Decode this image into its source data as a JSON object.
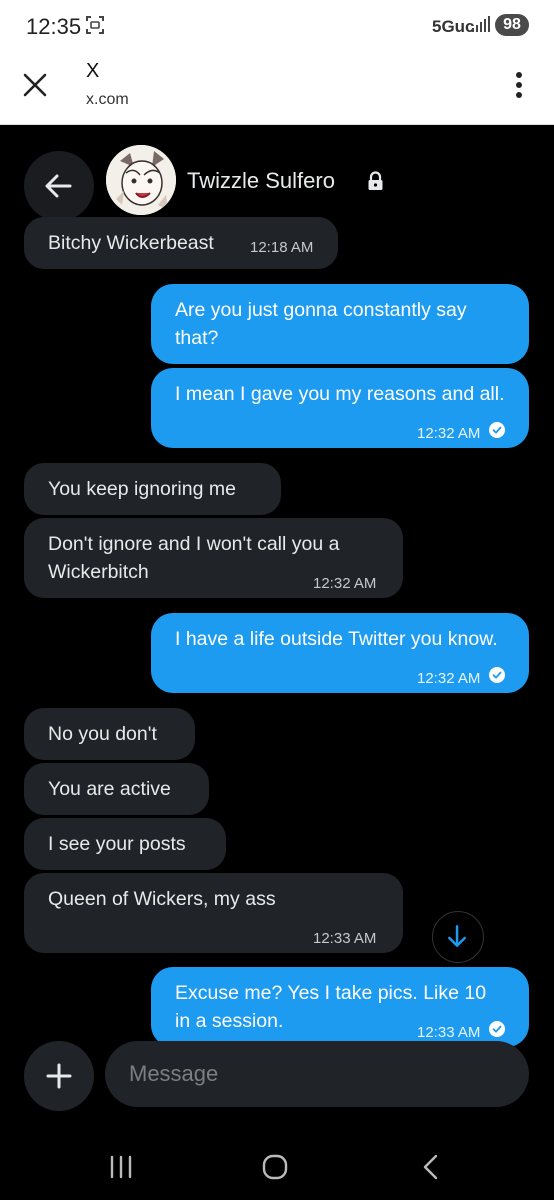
{
  "status_bar": {
    "time": "12:35",
    "network": "5Guc",
    "battery": "98"
  },
  "browser": {
    "title": "X",
    "url": "x.com"
  },
  "conversation": {
    "contact_name": "Twizzle Sulfero",
    "messages": [
      {
        "dir": "received",
        "text": "Bitchy Wickerbeast",
        "time": "12:18 AM"
      },
      {
        "dir": "sent",
        "text": "Are you just gonna constantly say that?",
        "time": ""
      },
      {
        "dir": "sent",
        "text": "I mean I gave you my reasons and all.",
        "time": "12:32 AM",
        "seen": true
      },
      {
        "dir": "received",
        "text": "You keep ignoring me",
        "time": ""
      },
      {
        "dir": "received",
        "text": "Don't ignore and I won't call you a Wickerbitch",
        "time": "12:32 AM"
      },
      {
        "dir": "sent",
        "text": "I have a life outside Twitter you know.",
        "time": "12:32 AM",
        "seen": true
      },
      {
        "dir": "received",
        "text": "No you don't",
        "time": ""
      },
      {
        "dir": "received",
        "text": "You are active",
        "time": ""
      },
      {
        "dir": "received",
        "text": "I see your posts",
        "time": ""
      },
      {
        "dir": "received",
        "text": "Queen of Wickers, my ass",
        "time": "12:33 AM"
      },
      {
        "dir": "sent",
        "text": "Excuse me? Yes I take pics. Like 10 in a session.",
        "time": "12:33 AM",
        "seen": true
      }
    ]
  },
  "composer": {
    "placeholder": "Message"
  },
  "colors": {
    "sent_bubble": "#1d9bf0",
    "received_bubble": "#202327",
    "background": "#000000"
  },
  "icons": [
    "screenshot-icon",
    "signal-icon",
    "close-icon",
    "more-vert-icon",
    "back-arrow-icon",
    "lock-icon",
    "check-circle-icon",
    "arrow-down-icon",
    "plus-icon",
    "nav-recents-icon",
    "nav-home-icon",
    "nav-back-icon"
  ]
}
